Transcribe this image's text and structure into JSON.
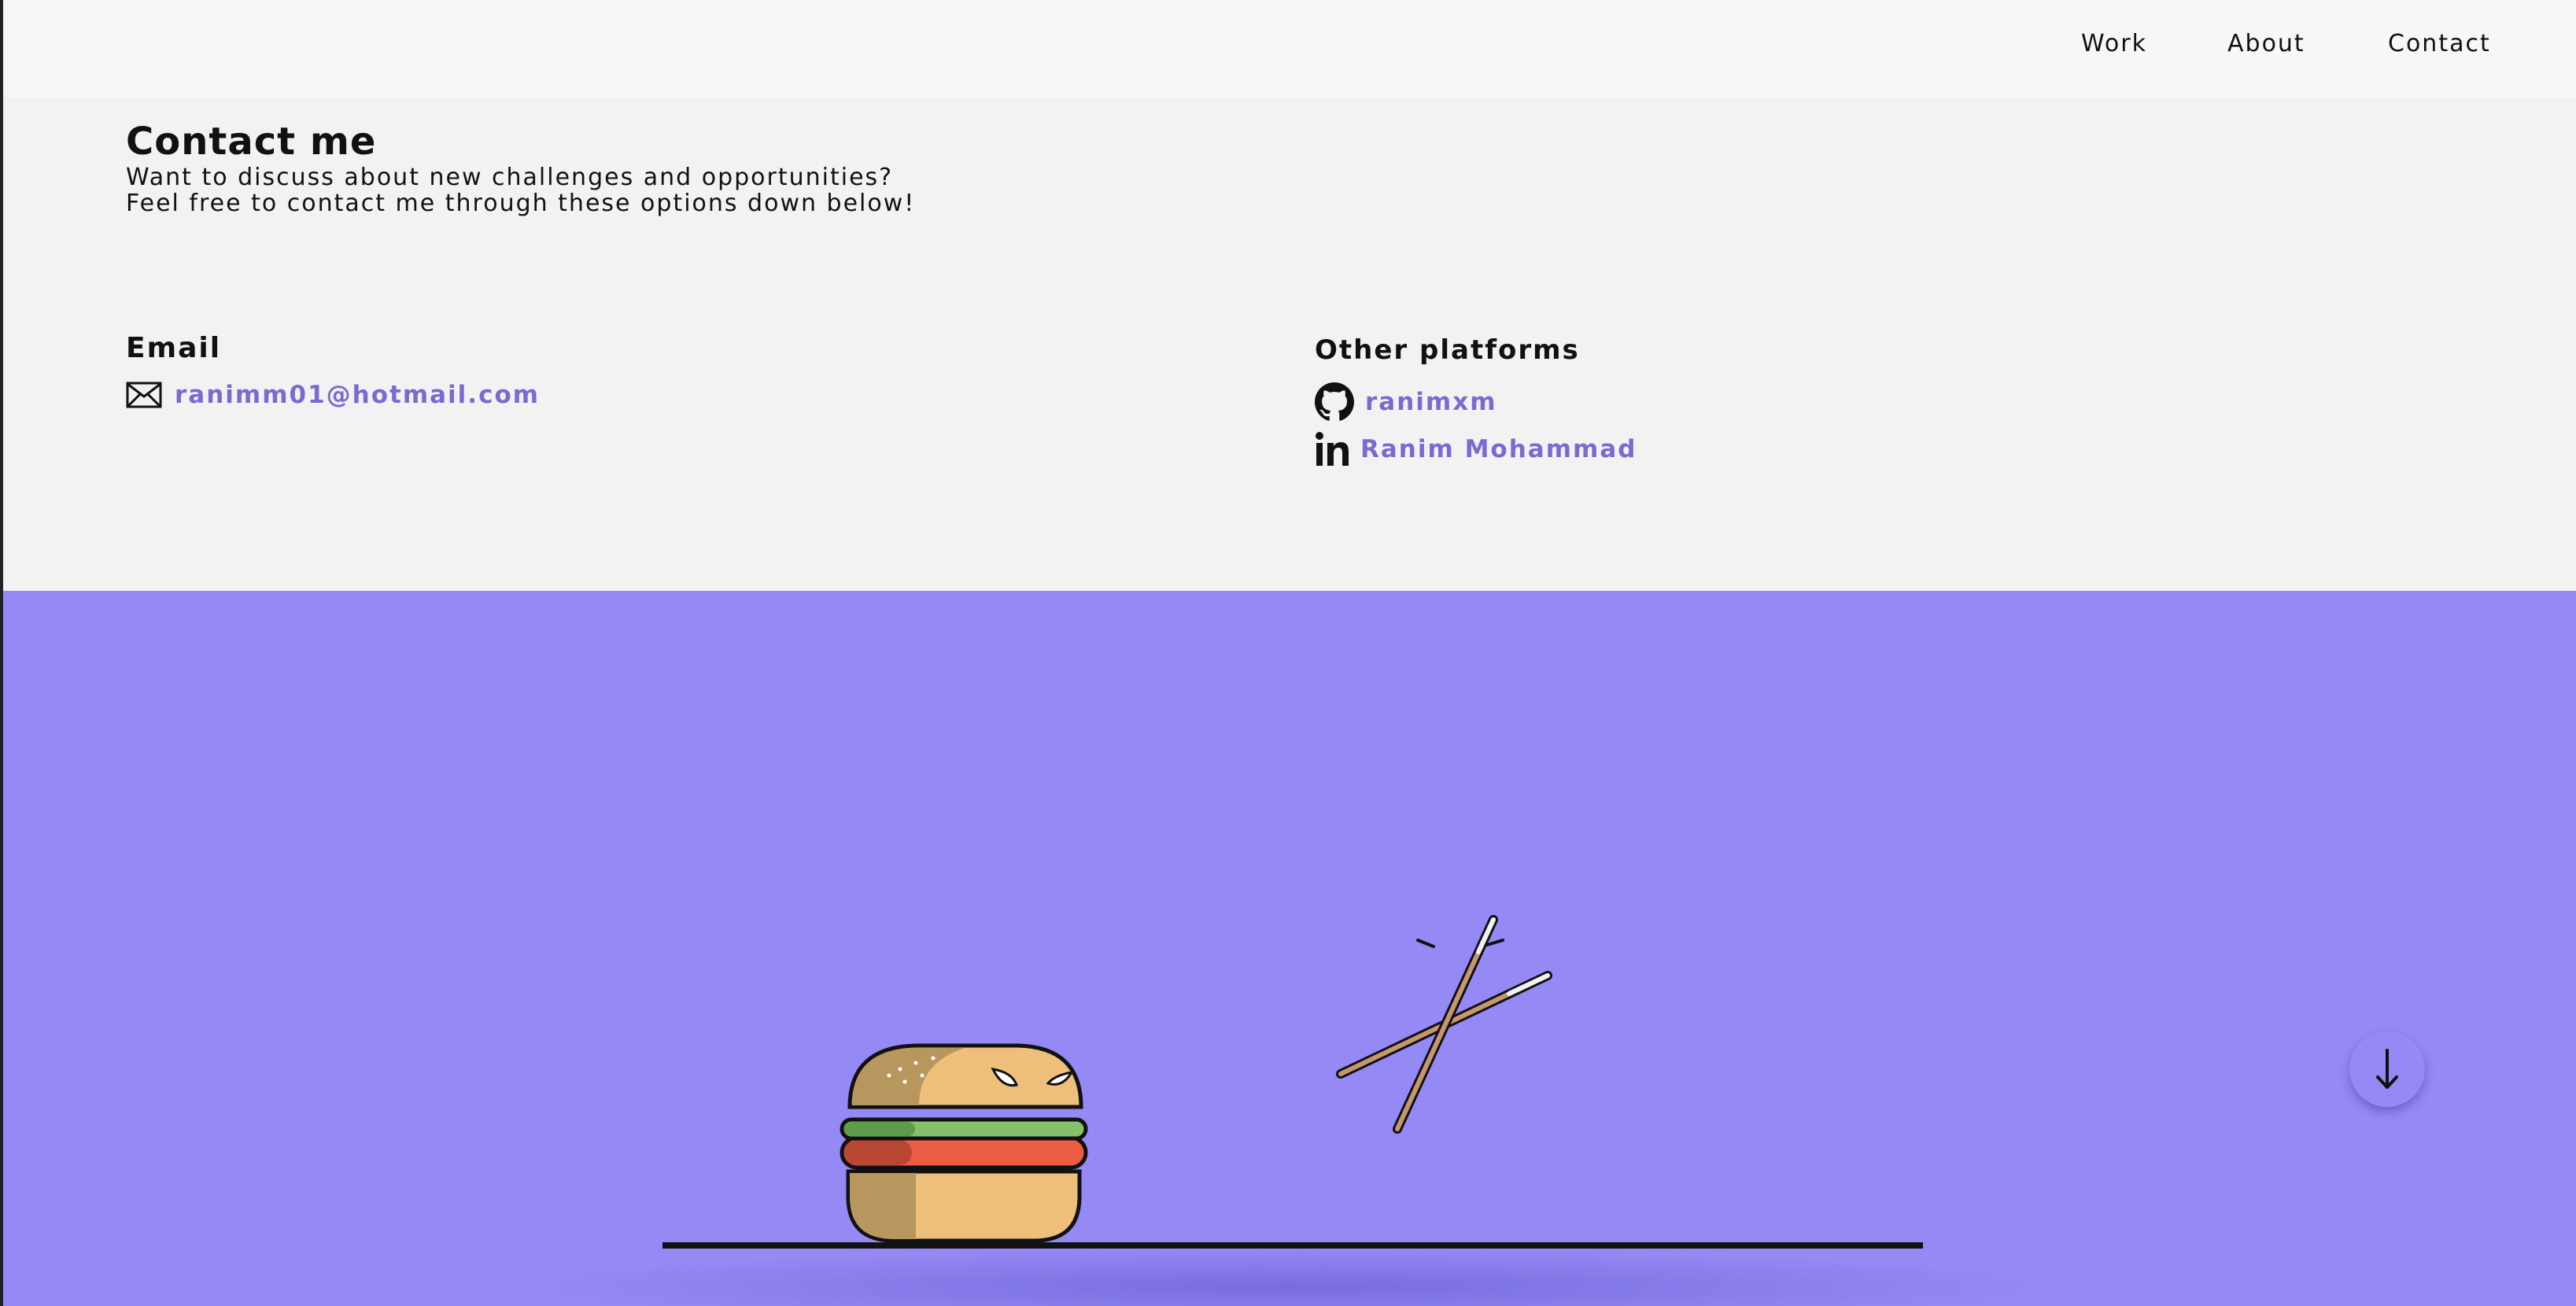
{
  "nav": {
    "work": "Work",
    "about": "About",
    "contact": "Contact"
  },
  "contact": {
    "title": "Contact me",
    "subtitle_line1": "Want to discuss about new challenges and opportunities?",
    "subtitle_line2": "Feel free to contact me through these options down below!",
    "email_heading": "Email",
    "email_address": "ranimm01@hotmail.com",
    "platforms_heading": "Other platforms",
    "github_handle": "ranimxm",
    "linkedin_name": "Ranim Mohammad"
  },
  "icons": {
    "email": "envelope-icon",
    "github": "github-icon",
    "linkedin": "linkedin-icon",
    "scroll": "arrow-down-icon"
  },
  "colors": {
    "link": "#7b6ad0",
    "scene_background": "#9489f5",
    "page_background": "#f2f2f2",
    "nav_background": "#f7f7f7"
  }
}
